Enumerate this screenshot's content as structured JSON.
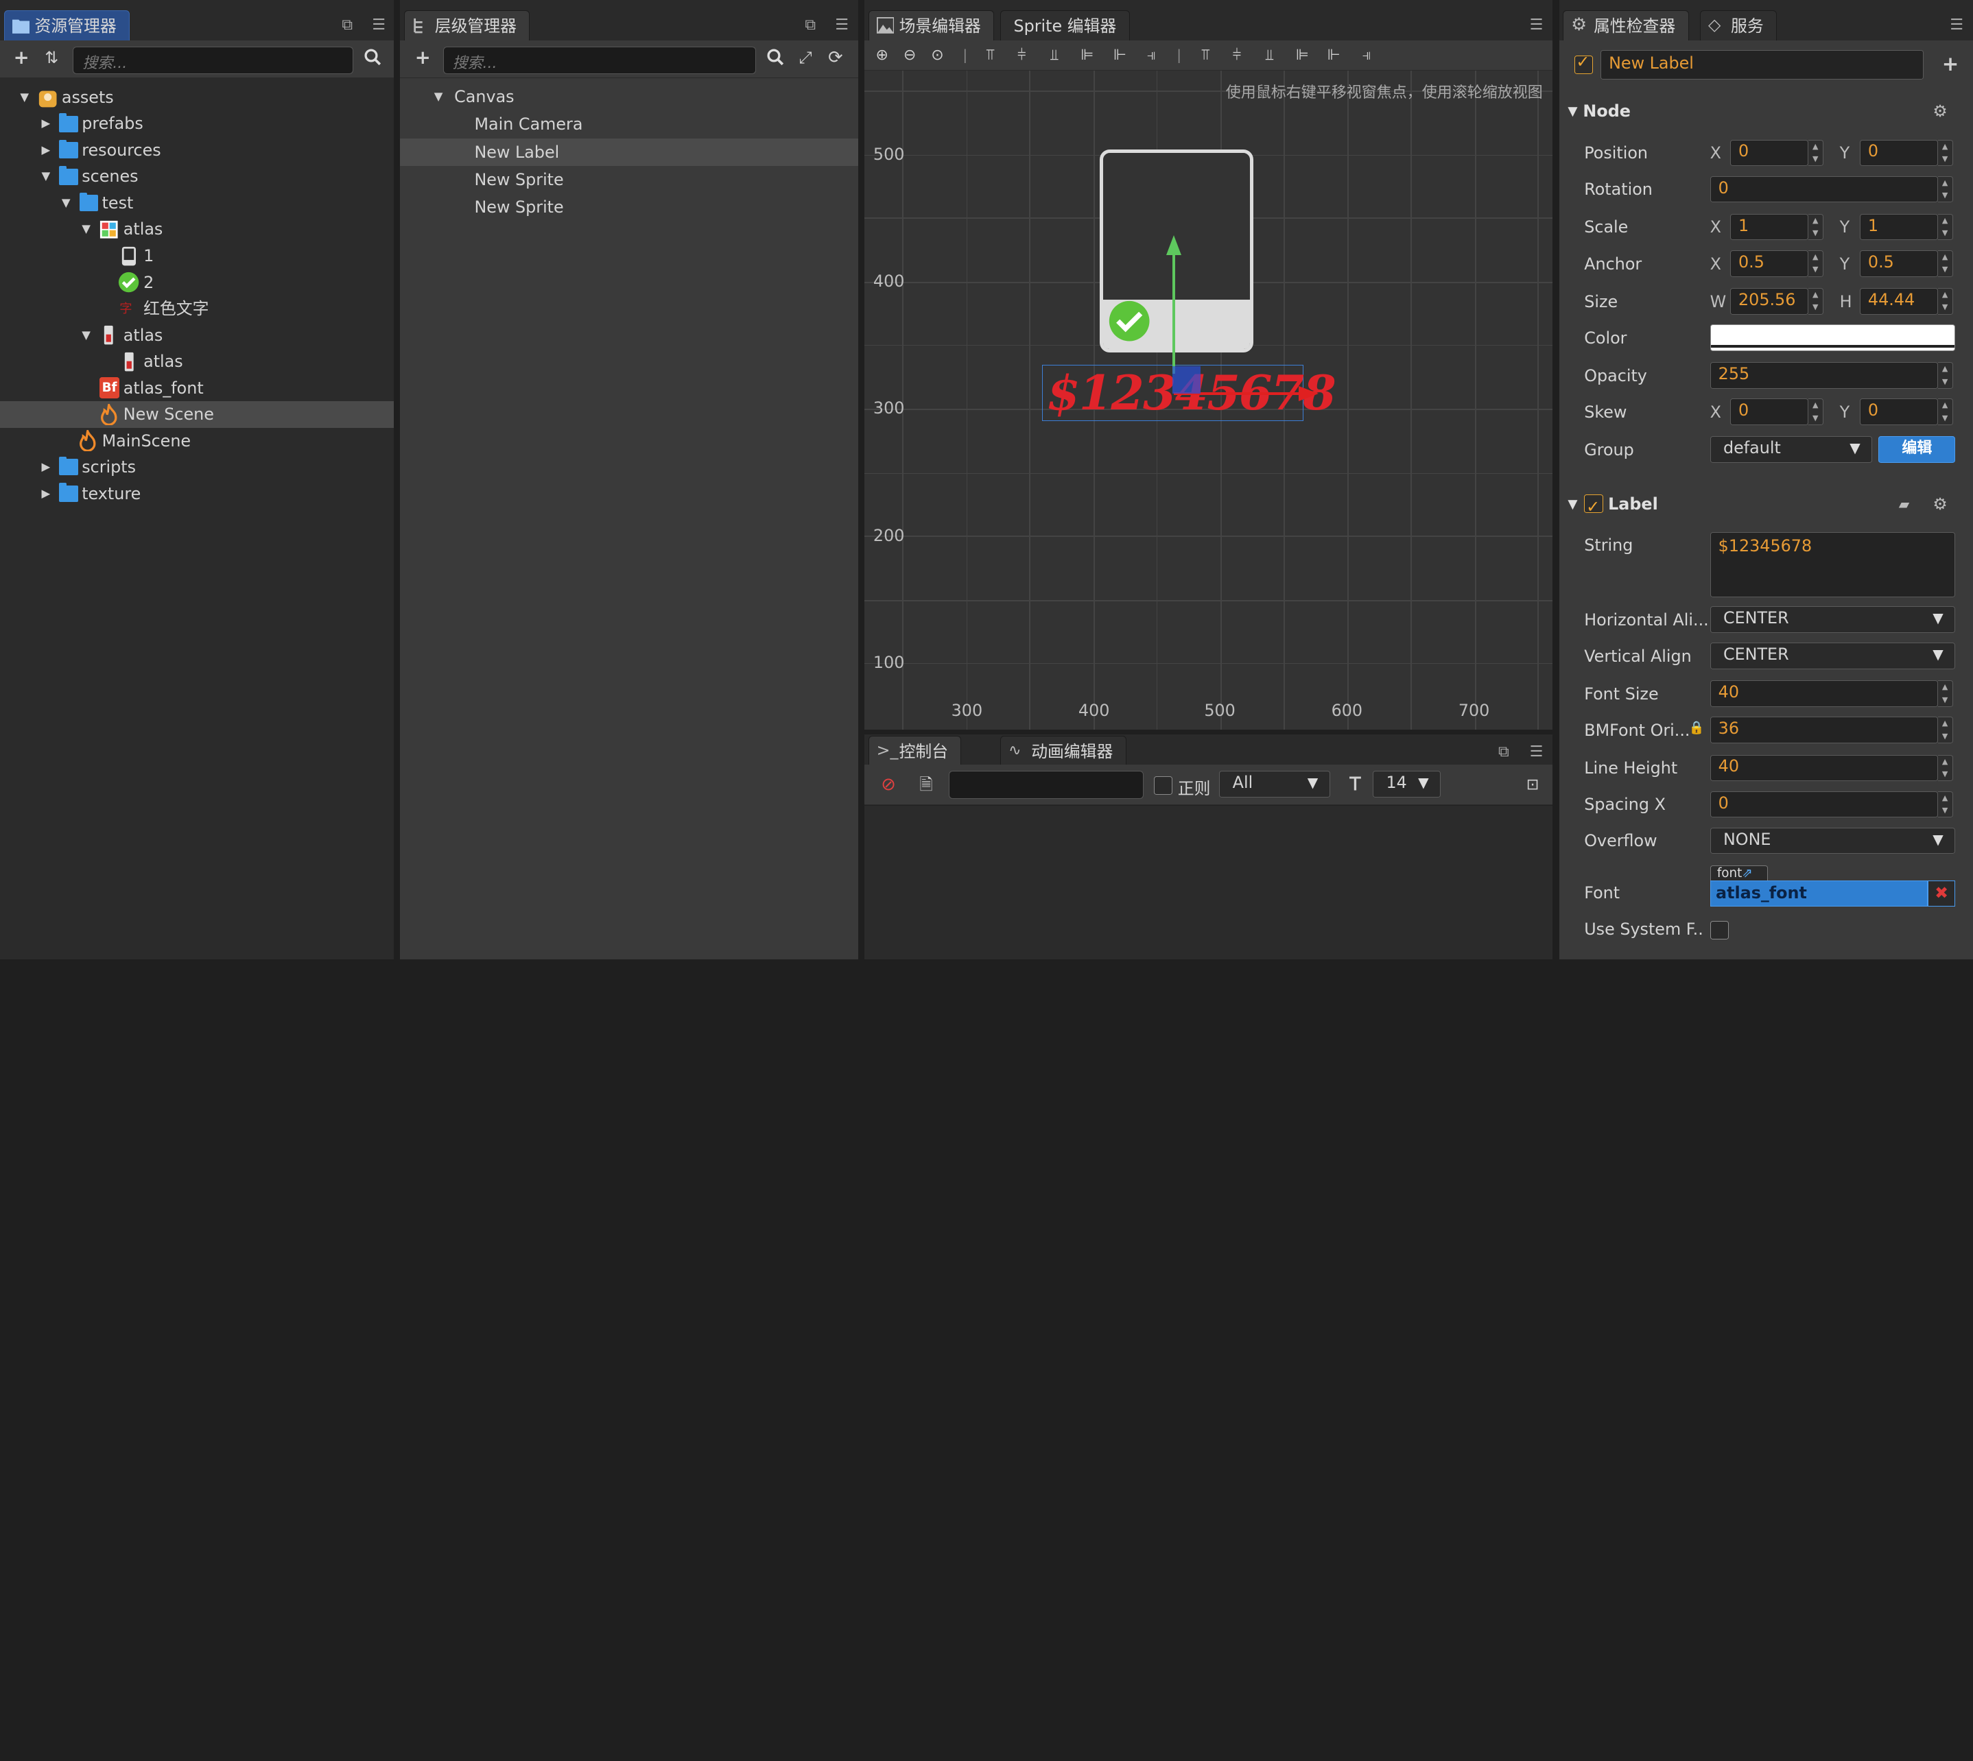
{
  "assets_panel": {
    "tab_label": "资源管理器",
    "search_placeholder": "搜索...",
    "items": [
      {
        "label": "assets",
        "icon": "assets-db-icon"
      },
      {
        "label": "prefabs",
        "icon": "folder-icon"
      },
      {
        "label": "resources",
        "icon": "folder-icon"
      },
      {
        "label": "scenes",
        "icon": "folder-icon"
      },
      {
        "label": "test",
        "icon": "folder-icon"
      },
      {
        "label": "atlas",
        "icon": "atlas-icon"
      },
      {
        "label": "1",
        "icon": "image-frame-icon"
      },
      {
        "label": "2",
        "icon": "check-circle-icon"
      },
      {
        "label": "红色文字",
        "icon": "red-text-icon"
      },
      {
        "label": "atlas",
        "icon": "label-atlas-icon"
      },
      {
        "label": "atlas",
        "icon": "label-atlas-icon"
      },
      {
        "label": "atlas_font",
        "icon": "bmfont-icon"
      },
      {
        "label": "New Scene",
        "icon": "scene-fire-icon"
      },
      {
        "label": "MainScene",
        "icon": "scene-fire-icon"
      },
      {
        "label": "scripts",
        "icon": "folder-icon"
      },
      {
        "label": "texture",
        "icon": "folder-icon"
      }
    ],
    "bmfont_badge": "Bf"
  },
  "hierarchy_panel": {
    "tab_label": "层级管理器",
    "search_placeholder": "搜索...",
    "nodes": [
      {
        "label": "Canvas"
      },
      {
        "label": "Main Camera"
      },
      {
        "label": "New Label"
      },
      {
        "label": "New Sprite"
      },
      {
        "label": "New Sprite"
      }
    ]
  },
  "scene_panel": {
    "tabs": [
      {
        "label": "场景编辑器"
      },
      {
        "label": "Sprite 编辑器"
      }
    ],
    "hint": "使用鼠标右键平移视窗焦点，使用滚轮缩放视图",
    "y_labels": [
      "500",
      "400",
      "300",
      "200",
      "100"
    ],
    "x_labels": [
      "300",
      "400",
      "500",
      "600",
      "700"
    ],
    "label_text": "$12345678"
  },
  "console_panel": {
    "tabs": [
      {
        "label": "控制台"
      },
      {
        "label": "动画编辑器"
      }
    ],
    "regex_label": "正则",
    "filter_value": "All",
    "font_size_value": "14"
  },
  "inspector": {
    "tabs": [
      {
        "label": "属性检查器"
      },
      {
        "label": "服务"
      }
    ],
    "node_name": "New Label",
    "node_section": "Node",
    "position": {
      "label": "Position",
      "x": "0",
      "y": "0"
    },
    "rotation": {
      "label": "Rotation",
      "value": "0"
    },
    "scale": {
      "label": "Scale",
      "x": "1",
      "y": "1"
    },
    "anchor": {
      "label": "Anchor",
      "x": "0.5",
      "y": "0.5"
    },
    "size": {
      "label": "Size",
      "w": "205.56",
      "h": "44.44"
    },
    "color": {
      "label": "Color",
      "value": "#ffffff"
    },
    "opacity": {
      "label": "Opacity",
      "value": "255"
    },
    "skew": {
      "label": "Skew",
      "x": "0",
      "y": "0"
    },
    "group": {
      "label": "Group",
      "value": "default",
      "edit_label": "编辑"
    },
    "label_section": "Label",
    "string": {
      "label": "String",
      "value": "$12345678"
    },
    "h_align": {
      "label": "Horizontal Ali...",
      "value": "CENTER"
    },
    "v_align": {
      "label": "Vertical Align",
      "value": "CENTER"
    },
    "font_size": {
      "label": "Font Size",
      "value": "40"
    },
    "bmfont_size": {
      "label": "BMFont Ori...",
      "value": "36"
    },
    "line_height": {
      "label": "Line Height",
      "value": "40"
    },
    "spacing_x": {
      "label": "Spacing X",
      "value": "0"
    },
    "overflow": {
      "label": "Overflow",
      "value": "NONE"
    },
    "font": {
      "label": "Font",
      "value": "atlas_font",
      "tag": "font"
    },
    "use_system_font": {
      "label": "Use System F..",
      "checked": false
    },
    "axis_labels": {
      "x": "X",
      "y": "Y",
      "w": "W",
      "h": "H"
    }
  },
  "colors": {
    "accent": "#3b98e6",
    "value_orange": "#e79b35",
    "panel": "#3a3a3a",
    "label_red": "#e0242a"
  }
}
